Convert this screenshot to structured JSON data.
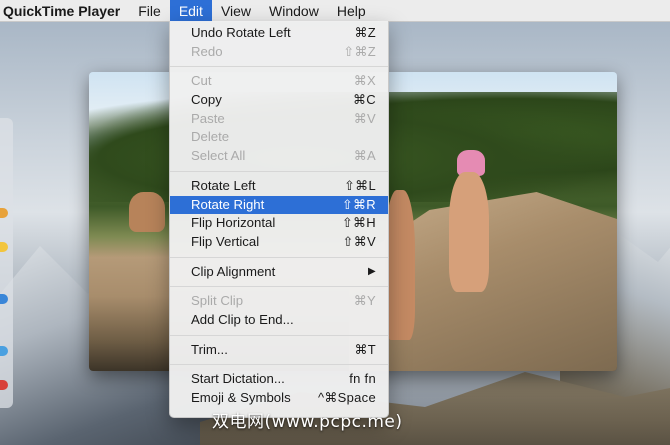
{
  "menubar": {
    "apple_icon": "apple-icon",
    "app_name": "QuickTime Player",
    "items": [
      "File",
      "Edit",
      "View",
      "Window",
      "Help"
    ],
    "active": "Edit"
  },
  "edit_menu": {
    "groups": [
      [
        {
          "label": "Undo Rotate Left",
          "shortcut": "⌘Z",
          "enabled": true
        },
        {
          "label": "Redo",
          "shortcut": "⇧⌘Z",
          "enabled": false
        }
      ],
      [
        {
          "label": "Cut",
          "shortcut": "⌘X",
          "enabled": false
        },
        {
          "label": "Copy",
          "shortcut": "⌘C",
          "enabled": true
        },
        {
          "label": "Paste",
          "shortcut": "⌘V",
          "enabled": false
        },
        {
          "label": "Delete",
          "shortcut": "",
          "enabled": false
        },
        {
          "label": "Select All",
          "shortcut": "⌘A",
          "enabled": false
        }
      ],
      [
        {
          "label": "Rotate Left",
          "shortcut": "⇧⌘L",
          "enabled": true
        },
        {
          "label": "Rotate Right",
          "shortcut": "⇧⌘R",
          "enabled": true,
          "highlighted": true
        },
        {
          "label": "Flip Horizontal",
          "shortcut": "⇧⌘H",
          "enabled": true
        },
        {
          "label": "Flip Vertical",
          "shortcut": "⇧⌘V",
          "enabled": true
        }
      ],
      [
        {
          "label": "Clip Alignment",
          "shortcut": "▶",
          "enabled": true,
          "submenu": true
        }
      ],
      [
        {
          "label": "Split Clip",
          "shortcut": "⌘Y",
          "enabled": false
        },
        {
          "label": "Add Clip to End...",
          "shortcut": "",
          "enabled": true
        }
      ],
      [
        {
          "label": "Trim...",
          "shortcut": "⌘T",
          "enabled": true
        }
      ],
      [
        {
          "label": "Start Dictation...",
          "shortcut": "fn fn",
          "enabled": true
        },
        {
          "label": "Emoji & Symbols",
          "shortcut": "^⌘Space",
          "enabled": true
        }
      ]
    ]
  },
  "watermark": "双电网(www.pcpc.me)",
  "colors": {
    "highlight": "#2d6fd6",
    "menubar_bg": "#ececec",
    "disabled_text": "#aaaaaa"
  }
}
